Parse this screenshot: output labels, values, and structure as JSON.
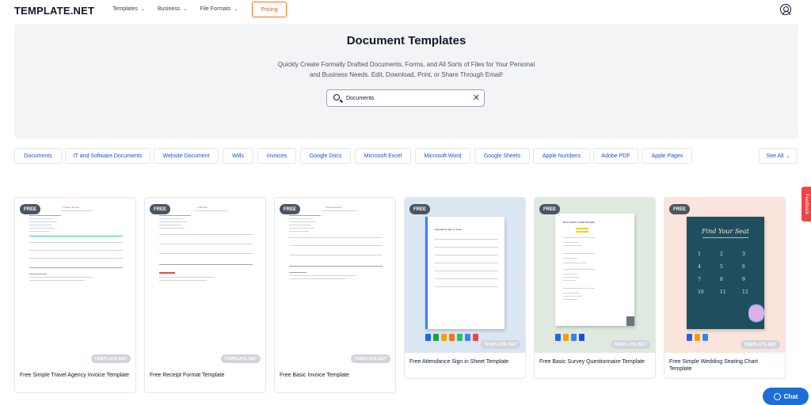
{
  "header": {
    "logo": "TEMPLATE.NET",
    "nav": [
      {
        "label": "Templates"
      },
      {
        "label": "Business"
      },
      {
        "label": "File Formats"
      }
    ],
    "pricing_label": "Pricing"
  },
  "hero": {
    "title": "Document Templates",
    "subtitle_line1": "Quickly Create Formally Drafted Documents, Forms, and All Sorts of Files for Your Personal",
    "subtitle_line2": "and Business Needs. Edit, Download, Print, or Share Through Email!",
    "search_value": "Documents"
  },
  "categories": [
    "Documents",
    "IT and Software Documents",
    "Website Document",
    "Wills",
    "Invoices",
    "Google Docs",
    "Microsoft Excel",
    "Microsoft Word",
    "Google Sheets",
    "Apple Numbers",
    "Adobe PDF",
    "Apple Pages"
  ],
  "see_all_label": "See All",
  "feedback_label": "Feedback",
  "cards": [
    {
      "badge": "FREE",
      "title": "Free Simple Travel Agency Invoice Template",
      "watermark": "TEMPLATE.NET",
      "doc_heading": "Traveler Invoice"
    },
    {
      "badge": "FREE",
      "title": "Free Receipt Format Template",
      "watermark": "TEMPLATE.NET",
      "doc_heading": "Collection"
    },
    {
      "badge": "FREE",
      "title": "Free Basic Invoice Template",
      "watermark": "TEMPLATE.NET",
      "doc_heading": "Invoice Receipt"
    },
    {
      "badge": "FREE",
      "title": "Free Attendance Sign in Sheet Template",
      "watermark": "TEMPLATE.NET",
      "doc_heading": "Attendance Sign-in Sheet"
    },
    {
      "badge": "FREE",
      "title": "Free Basic Survey Questionnaire Template",
      "watermark": "TEMPLATE.NET",
      "doc_heading": "BASIC SURVEY QUESTIONNAIRE"
    },
    {
      "badge": "FREE",
      "title": "Free Simple Wedding Seating Chart Template",
      "watermark": "TEMPLATE.NET",
      "doc_heading": "Find Your Seat"
    }
  ],
  "chat_label": "Chat",
  "colors": {
    "accent": "#1d6fd6",
    "pricing": "#ea580c",
    "badge": "#4b5563",
    "wedding": "#1f4e5f"
  }
}
